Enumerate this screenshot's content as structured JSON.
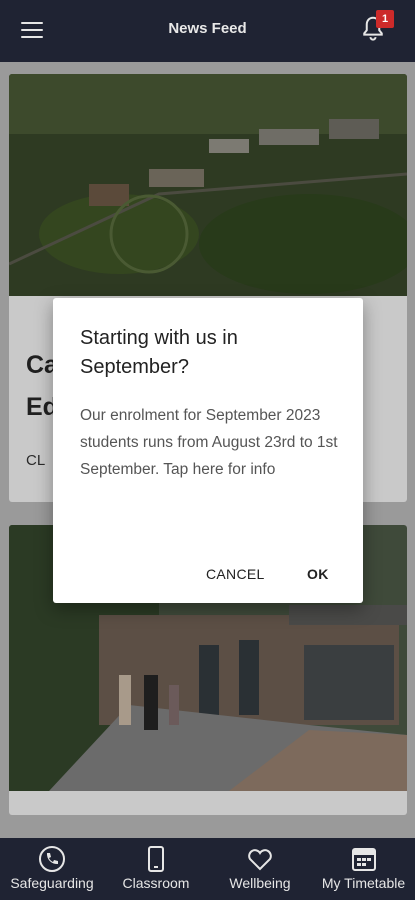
{
  "header": {
    "title": "News Feed",
    "notification_count": "1"
  },
  "feed": {
    "card1": {
      "heading_line1": "Ca",
      "heading_line2": "Ed",
      "subtext": "CL"
    }
  },
  "dialog": {
    "title": "Starting with us in September?",
    "body": "Our enrolment for September 2023 students runs from August 23rd to 1st September. Tap here for info",
    "cancel_label": "CANCEL",
    "ok_label": "OK"
  },
  "bottom_nav": {
    "items": [
      {
        "label": "Safeguarding",
        "icon": "phone-icon"
      },
      {
        "label": "Classroom",
        "icon": "tablet-icon"
      },
      {
        "label": "Wellbeing",
        "icon": "heart-icon"
      },
      {
        "label": "My Timetable",
        "icon": "calendar-icon"
      }
    ]
  },
  "colors": {
    "bar": "#1f2333",
    "badge": "#cc2a2a",
    "dialog_bg": "#ffffff"
  }
}
